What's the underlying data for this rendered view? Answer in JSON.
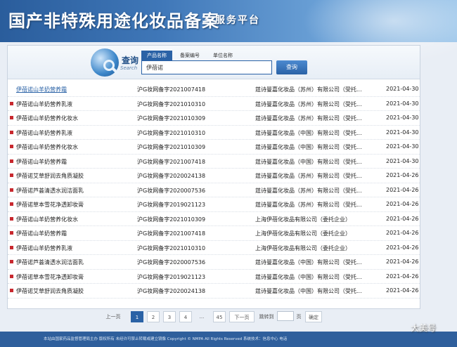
{
  "banner": {
    "title": "国产非特殊用途化妆品备案",
    "subtitle": "服务平台"
  },
  "search": {
    "label": "查询",
    "label_en": "Search",
    "tabs": [
      "产品名称",
      "备案编号",
      "单位名称"
    ],
    "active_tab": 0,
    "query": "伊蓓诺",
    "button": "查询"
  },
  "records": [
    {
      "name": "伊蓓诺山羊奶营养霜",
      "code": "沪G妆网备字2021007418",
      "company": "莛诗曼嘉化妆品（苏州）有限公司（受托...",
      "date": "2021-04-30"
    },
    {
      "name": "伊蓓诺山羊奶营养乳液",
      "code": "沪G妆网备字2021010310",
      "company": "莛诗曼嘉化妆品（苏州）有限公司（受托...",
      "date": "2021-04-30"
    },
    {
      "name": "伊蓓诺山羊奶营养化妆水",
      "code": "沪G妆网备字2021010309",
      "company": "莛诗曼嘉化妆品（苏州）有限公司（受托...",
      "date": "2021-04-30"
    },
    {
      "name": "伊蓓诺山羊奶营养乳液",
      "code": "沪G妆网备字2021010310",
      "company": "莛诗曼嘉化妆品（中国）有限公司（受托...",
      "date": "2021-04-30"
    },
    {
      "name": "伊蓓诺山羊奶营养化妆水",
      "code": "沪G妆网备字2021010309",
      "company": "莛诗曼嘉化妆品（中国）有限公司（受托...",
      "date": "2021-04-30"
    },
    {
      "name": "伊蓓诺山羊奶营养霜",
      "code": "沪G妆网备字2021007418",
      "company": "莛诗曼嘉化妆品（中国）有限公司（受托...",
      "date": "2021-04-30"
    },
    {
      "name": "伊蓓诺艾草舒润去角质凝胶",
      "code": "沪G妆网备字2020024138",
      "company": "莛诗曼嘉化妆品（苏州）有限公司（受托...",
      "date": "2021-04-26"
    },
    {
      "name": "伊蓓诺芦荟清透水润洁面乳",
      "code": "沪G妆网备字2020007536",
      "company": "莛诗曼嘉化妆品（苏州）有限公司（受托...",
      "date": "2021-04-26"
    },
    {
      "name": "伊蓓诺草本雪花净透卸妆膏",
      "code": "沪G妆网备字2019021123",
      "company": "莛诗曼嘉化妆品（苏州）有限公司（受托...",
      "date": "2021-04-26"
    },
    {
      "name": "伊蓓诺山羊奶营养化妆水",
      "code": "沪G妆网备字2021010309",
      "company": "上海伊蓓化妆品有限公司（委托企业）",
      "date": "2021-04-26"
    },
    {
      "name": "伊蓓诺山羊奶营养霜",
      "code": "沪G妆网备字2021007418",
      "company": "上海伊蓓化妆品有限公司（委托企业）",
      "date": "2021-04-26"
    },
    {
      "name": "伊蓓诺山羊奶营养乳液",
      "code": "沪G妆网备字2021010310",
      "company": "上海伊蓓化妆品有限公司（委托企业）",
      "date": "2021-04-26"
    },
    {
      "name": "伊蓓诺芦荟清透水润洁面乳",
      "code": "沪G妆网备字2020007536",
      "company": "莛诗曼嘉化妆品（中国）有限公司（受托...",
      "date": "2021-04-26"
    },
    {
      "name": "伊蓓诺草本雪花净透卸妆膏",
      "code": "沪G妆网备字2019021123",
      "company": "莛诗曼嘉化妆品（中国）有限公司（受托...",
      "date": "2021-04-26"
    },
    {
      "name": "伊蓓诺艾草舒润去角质凝胶",
      "code": "沪G妆网备字2020024138",
      "company": "莛诗曼嘉化妆品（中国）有限公司（受托...",
      "date": "2021-04-26"
    }
  ],
  "pagination": {
    "prev": "上一页",
    "pages": [
      "1",
      "2",
      "3",
      "4"
    ],
    "ellipsis": "...",
    "last": "45",
    "next": "下一页",
    "jump_label": "跳转到",
    "page_suffix": "页",
    "confirm": "确定"
  },
  "footer": {
    "text": "本站由国家药品监督管理局主办 版权所有 未经许可禁止转载或建立镜像 Copyright © NMPA All Rights Reserved 系统技术：信息中心 电话"
  },
  "watermark": "大美号",
  "colors": {
    "accent": "#2a62a6",
    "bullet": "#c8282e",
    "banner": "#3f77b8"
  },
  "icons": {
    "search": "globe-search-icon",
    "bullet": "square-bullet-icon"
  }
}
